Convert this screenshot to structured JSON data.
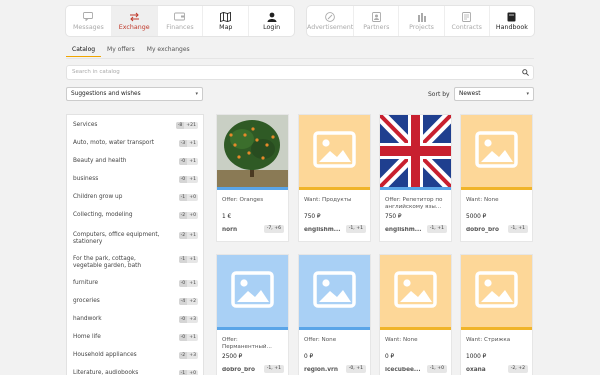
{
  "nav_left": [
    {
      "label": "Messages",
      "icon": "chat-icon",
      "active": false,
      "dark": false
    },
    {
      "label": "Exchange",
      "icon": "exchange-icon",
      "active": true,
      "dark": false
    },
    {
      "label": "Finances",
      "icon": "wallet-icon",
      "active": false,
      "dark": false
    },
    {
      "label": "Map",
      "icon": "map-icon",
      "active": false,
      "dark": true
    },
    {
      "label": "Login",
      "icon": "user-icon",
      "active": false,
      "dark": true
    }
  ],
  "nav_right": [
    {
      "label": "Advertisement",
      "icon": "megaphone-icon",
      "dark": false
    },
    {
      "label": "Partners",
      "icon": "partners-icon",
      "dark": false
    },
    {
      "label": "Projects",
      "icon": "projects-icon",
      "dark": false
    },
    {
      "label": "Contracts",
      "icon": "contract-icon",
      "dark": false
    },
    {
      "label": "Handbook",
      "icon": "book-icon",
      "dark": true
    }
  ],
  "tabs": [
    {
      "label": "Catalog",
      "active": true
    },
    {
      "label": "My offers",
      "active": false
    },
    {
      "label": "My exchanges",
      "active": false
    }
  ],
  "search": {
    "placeholder": "Search in catalog"
  },
  "filter": {
    "value": "Suggestions and wishes"
  },
  "sort": {
    "label": "Sort by",
    "value": "Newest"
  },
  "categories": [
    {
      "label": "Services",
      "neg": "-8",
      "pos": "+21"
    },
    {
      "label": "Auto, moto, water transport",
      "neg": "-3",
      "pos": "+1"
    },
    {
      "label": "Beauty and health",
      "neg": "-0",
      "pos": "+1"
    },
    {
      "label": "business",
      "neg": "-0",
      "pos": "+1"
    },
    {
      "label": "Children grow up",
      "neg": "-1",
      "pos": "+0"
    },
    {
      "label": "Collecting, modeling",
      "neg": "-2",
      "pos": "+0"
    },
    {
      "label": "Computers, office equipment, stationery",
      "neg": "-2",
      "pos": "+1"
    },
    {
      "label": "For the park, cottage, vegetable garden, bath",
      "neg": "-1",
      "pos": "+1"
    },
    {
      "label": "furniture",
      "neg": "-0",
      "pos": "+1"
    },
    {
      "label": "groceries",
      "neg": "-4",
      "pos": "+2"
    },
    {
      "label": "handwork",
      "neg": "-0",
      "pos": "+3"
    },
    {
      "label": "Home life",
      "neg": "-0",
      "pos": "+1"
    },
    {
      "label": "Household appliances",
      "neg": "-2",
      "pos": "+3"
    },
    {
      "label": "Literature, audiobooks",
      "neg": "-1",
      "pos": "+0"
    }
  ],
  "cards": [
    {
      "title": "Offer: Oranges",
      "price": "1 €",
      "user": "norn",
      "rating": "-7, +6",
      "image": "tree-photo",
      "placeholder": "",
      "stripe": "#5aa5e8"
    },
    {
      "title": "Want: Продукты",
      "price": "750 ₽",
      "user": "englishm...",
      "rating": "-1, +1",
      "image": "placeholder-image-icon",
      "placeholder": "#fdd798",
      "stripe": "#f0b429"
    },
    {
      "title": "Offer: Репетитор по английскому язы...",
      "price": "750 ₽",
      "user": "englishm...",
      "rating": "-1, +1",
      "image": "uk-flag-photo",
      "placeholder": "",
      "stripe": "#5aa5e8"
    },
    {
      "title": "Want: None",
      "price": "5000 ₽",
      "user": "dobro_bro",
      "rating": "-1, +1",
      "image": "placeholder-image-icon",
      "placeholder": "#fdd798",
      "stripe": "#f0b429"
    },
    {
      "title": "Offer: Перманентный...",
      "price": "2500 ₽",
      "user": "dobro_bro",
      "rating": "-1, +1",
      "image": "placeholder-image-icon",
      "placeholder": "#a9d0f5",
      "stripe": "#5aa5e8"
    },
    {
      "title": "Offer: None",
      "price": "0 ₽",
      "user": "region.vrn",
      "rating": "-0, +1",
      "image": "placeholder-image-icon",
      "placeholder": "#a9d0f5",
      "stripe": "#5aa5e8"
    },
    {
      "title": "Want: None",
      "price": "0 ₽",
      "user": "icecubee...",
      "rating": "-1, +0",
      "image": "placeholder-image-icon",
      "placeholder": "#fdd798",
      "stripe": "#f0b429"
    },
    {
      "title": "Want: Стрижка",
      "price": "1000 ₽",
      "user": "oxana",
      "rating": "-2, +2",
      "image": "placeholder-image-icon",
      "placeholder": "#fdd798",
      "stripe": "#f0b429"
    }
  ]
}
